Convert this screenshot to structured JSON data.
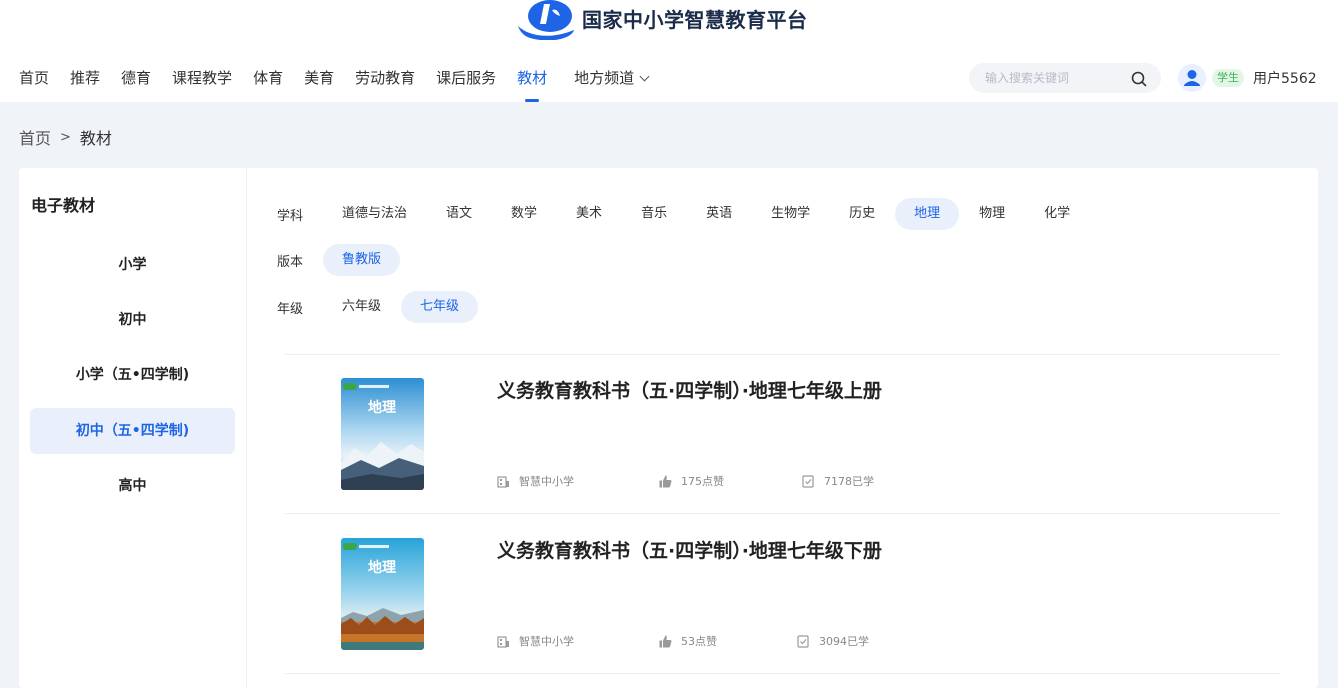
{
  "site": {
    "title": "国家中小学智慧教育平台"
  },
  "nav": {
    "items": [
      "首页",
      "推荐",
      "德育",
      "课程教学",
      "体育",
      "美育",
      "劳动教育",
      "课后服务",
      "教材"
    ],
    "active": "教材",
    "dropdown_label": "地方频道"
  },
  "search": {
    "placeholder": "输入搜索关键词"
  },
  "user": {
    "role": "学生",
    "name": "用户5562"
  },
  "breadcrumb": {
    "home": "首页",
    "separator": ">",
    "current": "教材"
  },
  "sidebar": {
    "title": "电子教材",
    "stages": [
      "小学",
      "初中",
      "小学（五•四学制)",
      "初中（五•四学制)",
      "高中"
    ],
    "active_index": 3
  },
  "filters": {
    "subject": {
      "label": "学科",
      "options": [
        "道德与法治",
        "语文",
        "数学",
        "美术",
        "音乐",
        "英语",
        "生物学",
        "历史",
        "地理",
        "物理",
        "化学"
      ],
      "active": "地理"
    },
    "edition": {
      "label": "版本",
      "options": [
        "鲁教版"
      ],
      "active": "鲁教版"
    },
    "grade": {
      "label": "年级",
      "options": [
        "六年级",
        "七年级"
      ],
      "active": "七年级"
    }
  },
  "books": [
    {
      "title": "义务教育教科书（五·四学制）·地理七年级上册",
      "publisher": "智慧中小学",
      "likes": "175点赞",
      "learners": "7178已学",
      "cover_word": "地理"
    },
    {
      "title": "义务教育教科书（五·四学制）·地理七年级下册",
      "publisher": "智慧中小学",
      "likes": "53点赞",
      "learners": "3094已学",
      "cover_word": "地理"
    }
  ],
  "colors": {
    "accent": "#1e64e6",
    "active_bg": "#e9f0fc",
    "page_bg": "#f0f3f8",
    "badge_green": "#3bb356"
  }
}
